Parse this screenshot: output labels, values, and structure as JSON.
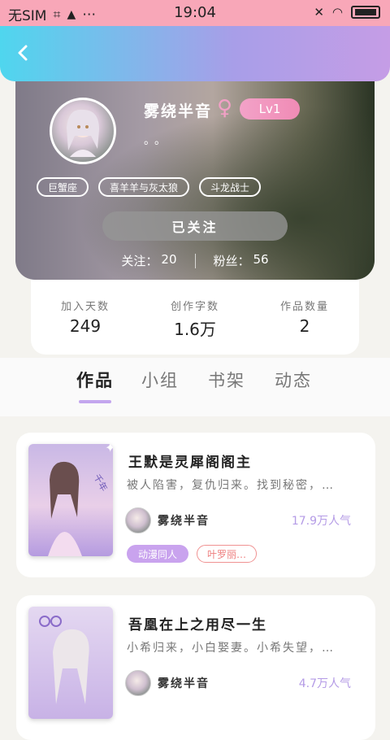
{
  "status_bar": {
    "carrier": "无SIM",
    "time": "19:04"
  },
  "profile": {
    "username": "雾绕半音",
    "gender_symbol": "♀",
    "level": "Lv1",
    "bio": "。。",
    "tags": [
      "巨蟹座",
      "喜羊羊与灰太狼",
      "斗龙战士"
    ],
    "follow_button": "已关注",
    "following_label": "关注：",
    "following_count": "20",
    "fans_label": "粉丝：",
    "fans_count": "56"
  },
  "stats": [
    {
      "label": "加入天数",
      "value": "249"
    },
    {
      "label": "创作字数",
      "value": "1.6万"
    },
    {
      "label": "作品数量",
      "value": "2"
    }
  ],
  "tabs": [
    "作品",
    "小组",
    "书架",
    "动态"
  ],
  "works": [
    {
      "title": "王默是灵犀阁阁主",
      "description": "被人陷害，复仇归来。找到秘密，…",
      "author": "雾绕半音",
      "popularity": "17.9万人气",
      "tag_primary": "动漫同人",
      "tag_secondary": "叶罗丽…"
    },
    {
      "title": "吾凰在上之用尽一生",
      "description": "小希归来，小白娶妻。小希失望，…",
      "author": "雾绕半音",
      "popularity": "4.7万人气"
    }
  ]
}
